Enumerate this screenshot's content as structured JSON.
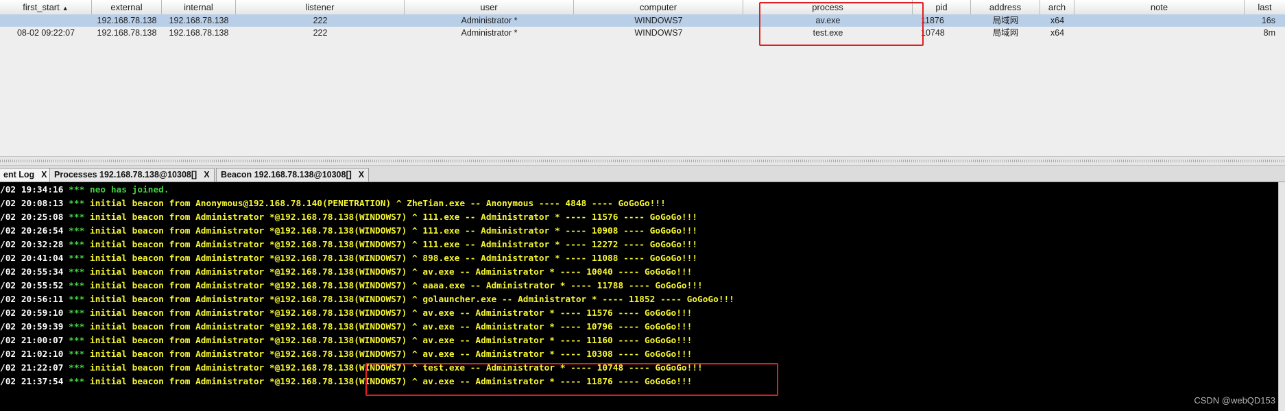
{
  "table": {
    "columns": [
      "first_start",
      "external",
      "internal",
      "listener",
      "user",
      "computer",
      "process",
      "pid",
      "address",
      "arch",
      "note",
      "last"
    ],
    "sort_indicator": "▲",
    "rows": [
      [
        "",
        "192.168.78.138",
        "192.168.78.138",
        "222",
        "Administrator *",
        "WINDOWS7",
        "av.exe",
        "11876",
        "局域网",
        "x64",
        "",
        "16s"
      ],
      [
        "08-02 09:22:07",
        "192.168.78.138",
        "192.168.78.138",
        "222",
        "Administrator *",
        "WINDOWS7",
        "test.exe",
        "10748",
        "局域网",
        "x64",
        "",
        "8m"
      ]
    ]
  },
  "tabs": [
    {
      "label": "ent Log",
      "close": "X"
    },
    {
      "label": "Processes 192.168.78.138@10308[]",
      "close": "X"
    },
    {
      "label": "Beacon 192.168.78.138@10308[]",
      "close": "X"
    }
  ],
  "log": [
    {
      "time": "/02 19:34:16",
      "stars": "***",
      "msg": "neo has joined.",
      "style": "green"
    },
    {
      "time": "/02 20:08:13",
      "stars": "***",
      "msg": "initial beacon from Anonymous@192.168.78.140(PENETRATION) ^ ZheTian.exe -- Anonymous ---- 4848 ---- GoGoGo!!!",
      "style": "yellow"
    },
    {
      "time": "/02 20:25:08",
      "stars": "***",
      "msg": "initial beacon from Administrator *@192.168.78.138(WINDOWS7) ^ 111.exe -- Administrator * ---- 11576 ---- GoGoGo!!!",
      "style": "yellow"
    },
    {
      "time": "/02 20:26:54",
      "stars": "***",
      "msg": "initial beacon from Administrator *@192.168.78.138(WINDOWS7) ^ 111.exe -- Administrator * ---- 10908 ---- GoGoGo!!!",
      "style": "yellow"
    },
    {
      "time": "/02 20:32:28",
      "stars": "***",
      "msg": "initial beacon from Administrator *@192.168.78.138(WINDOWS7) ^ 111.exe -- Administrator * ---- 12272 ---- GoGoGo!!!",
      "style": "yellow"
    },
    {
      "time": "/02 20:41:04",
      "stars": "***",
      "msg": "initial beacon from Administrator *@192.168.78.138(WINDOWS7) ^ 898.exe -- Administrator * ---- 11088 ---- GoGoGo!!!",
      "style": "yellow"
    },
    {
      "time": "/02 20:55:34",
      "stars": "***",
      "msg": "initial beacon from Administrator *@192.168.78.138(WINDOWS7) ^ av.exe -- Administrator * ---- 10040 ---- GoGoGo!!!",
      "style": "yellow"
    },
    {
      "time": "/02 20:55:52",
      "stars": "***",
      "msg": "initial beacon from Administrator *@192.168.78.138(WINDOWS7) ^ aaaa.exe -- Administrator * ---- 11788 ---- GoGoGo!!!",
      "style": "yellow"
    },
    {
      "time": "/02 20:56:11",
      "stars": "***",
      "msg": "initial beacon from Administrator *@192.168.78.138(WINDOWS7) ^ golauncher.exe -- Administrator * ---- 11852 ---- GoGoGo!!!",
      "style": "yellow"
    },
    {
      "time": "/02 20:59:10",
      "stars": "***",
      "msg": "initial beacon from Administrator *@192.168.78.138(WINDOWS7) ^ av.exe -- Administrator * ---- 11576 ---- GoGoGo!!!",
      "style": "yellow"
    },
    {
      "time": "/02 20:59:39",
      "stars": "***",
      "msg": "initial beacon from Administrator *@192.168.78.138(WINDOWS7) ^ av.exe -- Administrator * ---- 10796 ---- GoGoGo!!!",
      "style": "yellow"
    },
    {
      "time": "/02 21:00:07",
      "stars": "***",
      "msg": "initial beacon from Administrator *@192.168.78.138(WINDOWS7) ^ av.exe -- Administrator * ---- 11160 ---- GoGoGo!!!",
      "style": "yellow"
    },
    {
      "time": "/02 21:02:10",
      "stars": "***",
      "msg": "initial beacon from Administrator *@192.168.78.138(WINDOWS7) ^ av.exe -- Administrator * ---- 10308 ---- GoGoGo!!!",
      "style": "yellow"
    },
    {
      "time": "/02 21:22:07",
      "stars": "***",
      "msg": "initial beacon from Administrator *@192.168.78.138(WINDOWS7) ^ test.exe -- Administrator * ---- 10748 ---- GoGoGo!!!",
      "style": "yellow"
    },
    {
      "time": "/02 21:37:54",
      "stars": "***",
      "msg": "initial beacon from Administrator *@192.168.78.138(WINDOWS7) ^ av.exe -- Administrator * ---- 11876 ---- GoGoGo!!!",
      "style": "yellow"
    }
  ],
  "watermark": "CSDN @webQD153",
  "colors": {
    "selected_row": "#b9cfe7",
    "console_bg": "#000000",
    "log_time": "#ffffff",
    "log_stars": "#44d144",
    "log_join": "#44d144",
    "log_beacon": "#f6f632",
    "annotation": "#e02020"
  }
}
